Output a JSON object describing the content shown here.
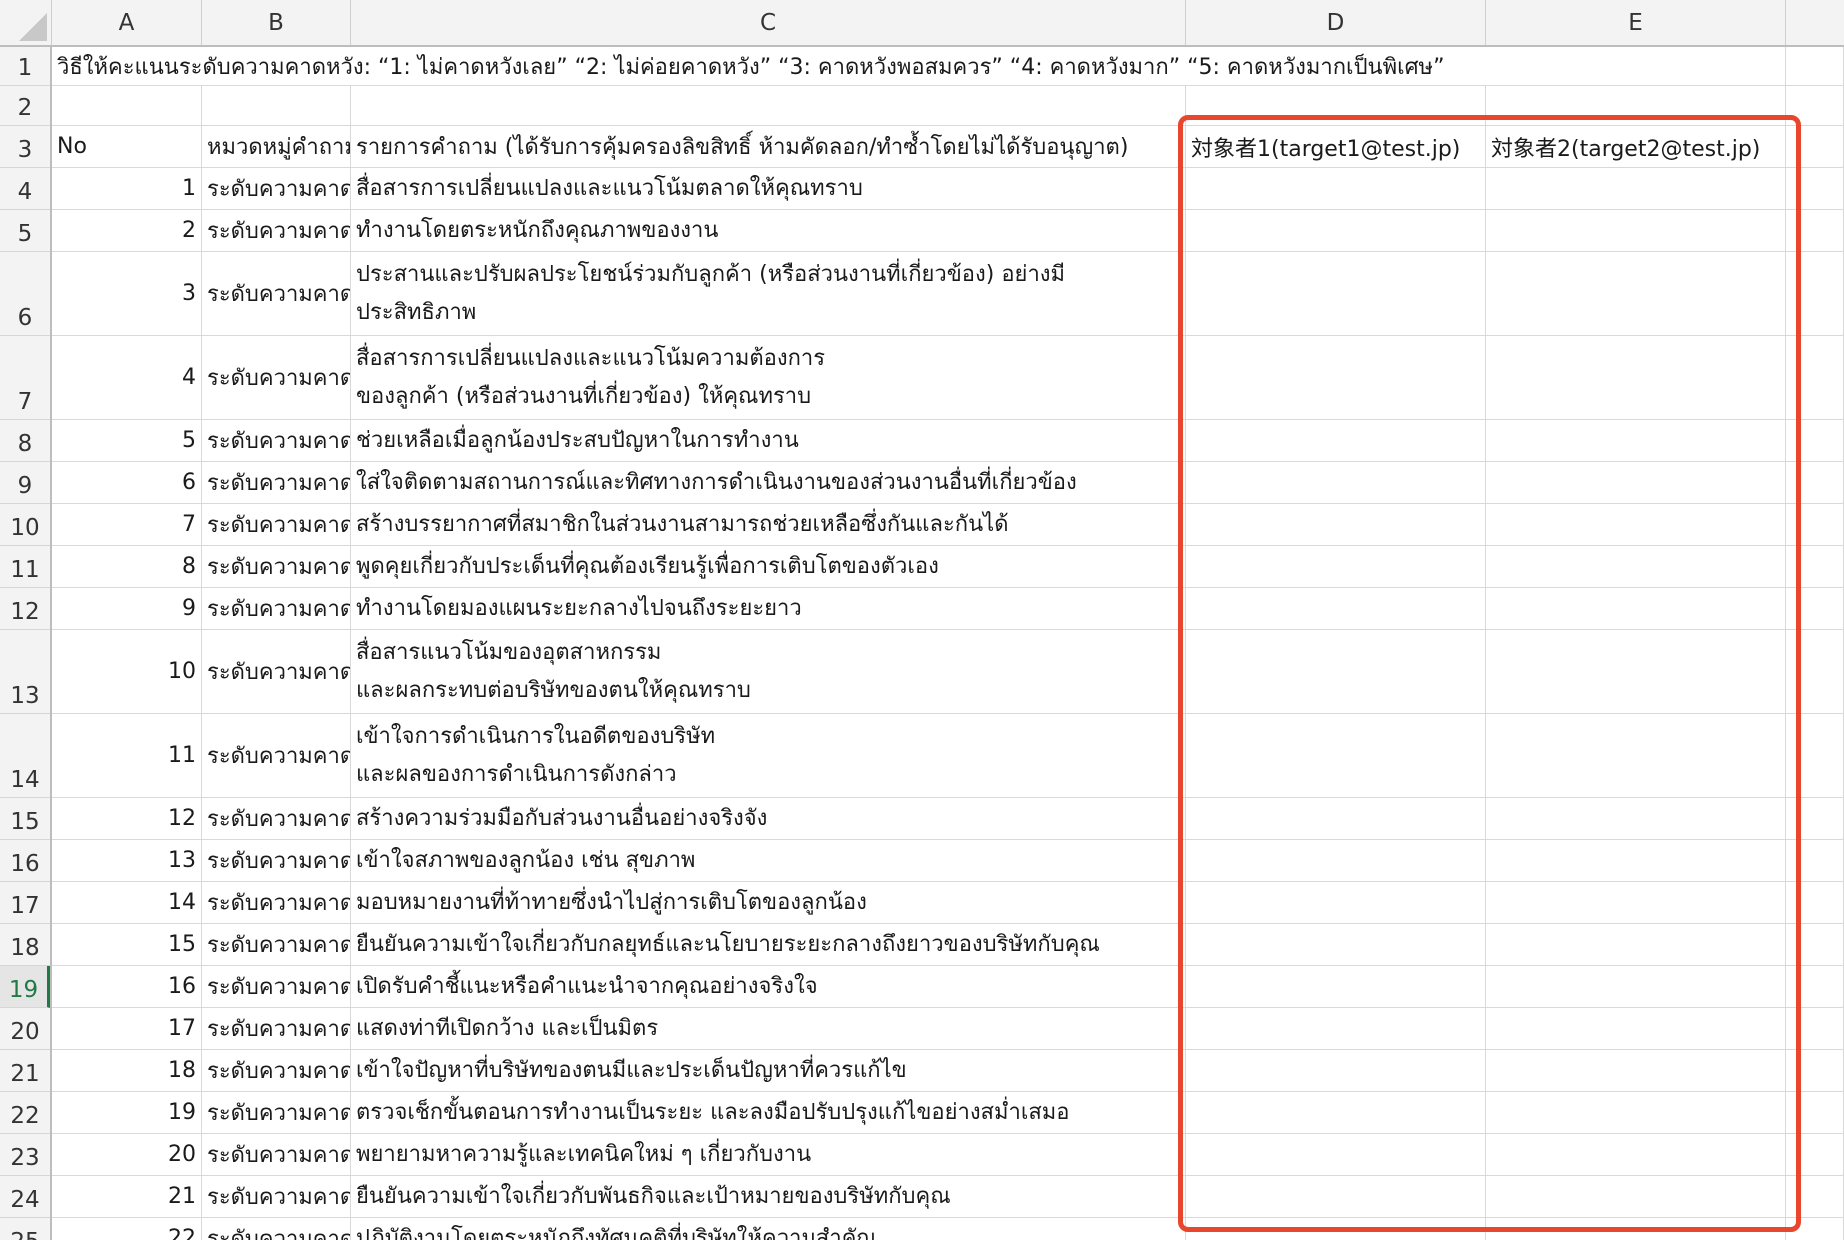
{
  "columns": [
    "A",
    "B",
    "C",
    "D",
    "E"
  ],
  "row1_text": "วิธีให้คะแนนระดับความคาดหวัง: “1: ไม่คาดหวังเลย” “2: ไม่ค่อยคาดหวัง” “3: คาดหวังพอสมควร” “4: คาดหวังมาก” “5: คาดหวังมากเป็นพิเศษ”",
  "header_row": {
    "no": "No",
    "category": "หมวดหมู่คำถาม",
    "question": "รายการคำถาม (ได้รับการคุ้มครองลิขสิทธิ์ ห้ามคัดลอก/ทำซ้ำโดยไม่ได้รับอนุญาต)",
    "target1": "対象者1(target1@test.jp)",
    "target2": "対象者2(target2@test.jp)"
  },
  "category_label": "ระดับความคาดหวัง",
  "rows": [
    {
      "rownum": "4",
      "no": "1",
      "lines": [
        "สื่อสารการเปลี่ยนแปลงและแนวโน้มตลาดให้คุณทราบ"
      ]
    },
    {
      "rownum": "5",
      "no": "2",
      "lines": [
        "ทำงานโดยตระหนักถึงคุณภาพของงาน"
      ]
    },
    {
      "rownum": "6",
      "no": "3",
      "lines": [
        "ประสานและปรับผลประโยชน์ร่วมกับลูกค้า (หรือส่วนงานที่เกี่ยวข้อง) อย่างมี",
        "ประสิทธิภาพ"
      ]
    },
    {
      "rownum": "7",
      "no": "4",
      "lines": [
        "สื่อสารการเปลี่ยนแปลงและแนวโน้มความต้องการ",
        "ของลูกค้า (หรือส่วนงานที่เกี่ยวข้อง) ให้คุณทราบ"
      ]
    },
    {
      "rownum": "8",
      "no": "5",
      "lines": [
        "ช่วยเหลือเมื่อลูกน้องประสบปัญหาในการทำงาน"
      ]
    },
    {
      "rownum": "9",
      "no": "6",
      "lines": [
        "ใส่ใจติดตามสถานการณ์และทิศทางการดำเนินงานของส่วนงานอื่นที่เกี่ยวข้อง"
      ]
    },
    {
      "rownum": "10",
      "no": "7",
      "lines": [
        "สร้างบรรยากาศที่สมาชิกในส่วนงานสามารถช่วยเหลือซึ่งกันและกันได้"
      ]
    },
    {
      "rownum": "11",
      "no": "8",
      "lines": [
        "พูดคุยเกี่ยวกับประเด็นที่คุณต้องเรียนรู้เพื่อการเติบโตของตัวเอง"
      ]
    },
    {
      "rownum": "12",
      "no": "9",
      "lines": [
        "ทำงานโดยมองแผนระยะกลางไปจนถึงระยะยาว"
      ]
    },
    {
      "rownum": "13",
      "no": "10",
      "lines": [
        "สื่อสารแนวโน้มของอุตสาหกรรม",
        "และผลกระทบต่อบริษัทของตนให้คุณทราบ"
      ]
    },
    {
      "rownum": "14",
      "no": "11",
      "lines": [
        "เข้าใจการดำเนินการในอดีตของบริษัท",
        "และผลของการดำเนินการดังกล่าว"
      ]
    },
    {
      "rownum": "15",
      "no": "12",
      "lines": [
        "สร้างความร่วมมือกับส่วนงานอื่นอย่างจริงจัง"
      ]
    },
    {
      "rownum": "16",
      "no": "13",
      "lines": [
        "เข้าใจสภาพของลูกน้อง เช่น สุขภาพ"
      ]
    },
    {
      "rownum": "17",
      "no": "14",
      "lines": [
        "มอบหมายงานที่ท้าทายซึ่งนำไปสู่การเติบโตของลูกน้อง"
      ]
    },
    {
      "rownum": "18",
      "no": "15",
      "lines": [
        "ยืนยันความเข้าใจเกี่ยวกับกลยุทธ์และนโยบายระยะกลางถึงยาวของบริษัทกับคุณ"
      ]
    },
    {
      "rownum": "19",
      "no": "16",
      "lines": [
        "เปิดรับคำชี้แนะหรือคำแนะนำจากคุณอย่างจริงใจ"
      ]
    },
    {
      "rownum": "20",
      "no": "17",
      "lines": [
        "แสดงท่าทีเปิดกว้าง และเป็นมิตร"
      ]
    },
    {
      "rownum": "21",
      "no": "18",
      "lines": [
        "เข้าใจปัญหาที่บริษัทของตนมีและประเด็นปัญหาที่ควรแก้ไข"
      ]
    },
    {
      "rownum": "22",
      "no": "19",
      "lines": [
        "ตรวจเช็กขั้นตอนการทำงานเป็นระยะ และลงมือปรับปรุงแก้ไขอย่างสม่ำเสมอ"
      ]
    },
    {
      "rownum": "23",
      "no": "20",
      "lines": [
        "พยายามหาความรู้และเทคนิคใหม่ ๆ เกี่ยวกับงาน"
      ]
    },
    {
      "rownum": "24",
      "no": "21",
      "lines": [
        "ยืนยันความเข้าใจเกี่ยวกับพันธกิจและเป้าหมายของบริษัทกับคุณ"
      ]
    },
    {
      "rownum": "25",
      "no": "22",
      "lines": [
        "ปฏิบัติงานโดยตระหนักถึงทัศนคติที่บริษัทให้ความสำคัญ"
      ]
    }
  ],
  "active_row": "19",
  "highlight_color": "#e8472e"
}
